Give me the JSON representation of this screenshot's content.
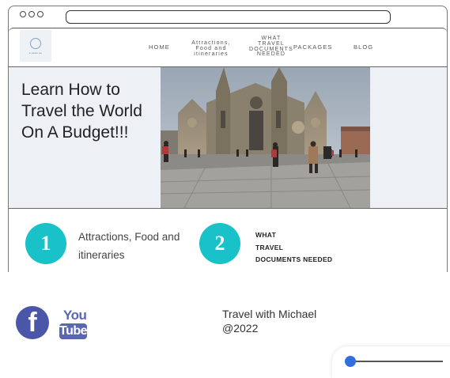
{
  "nav": {
    "home": "HOME",
    "attractions": [
      "Attractions,",
      "Food and",
      "itineraries"
    ],
    "documents": [
      "WHAT",
      "TRAVEL",
      "DOCUMENTS",
      "NEEDED"
    ],
    "packages": "PACKAGES",
    "blog": "BLOG"
  },
  "hero": {
    "title_lines": [
      "Learn How to",
      "Travel the World",
      "On A Budget!!!"
    ]
  },
  "features": [
    {
      "number": "1",
      "lines": [
        "Attractions, Food and",
        "itineraries"
      ]
    },
    {
      "number": "2",
      "lines": [
        "WHAT",
        "TRAVEL",
        "DOCUMENTS NEEDED"
      ]
    }
  ],
  "footer": {
    "youtube_top": "You",
    "youtube_bottom": "Tube",
    "facebook_glyph": "f",
    "lines": [
      "Travel with Michael",
      "@2022"
    ]
  },
  "colors": {
    "accent": "#19c1c8",
    "social": "#4a56a8"
  },
  "icons": [
    "facebook-icon",
    "youtube-icon",
    "site-logo"
  ]
}
